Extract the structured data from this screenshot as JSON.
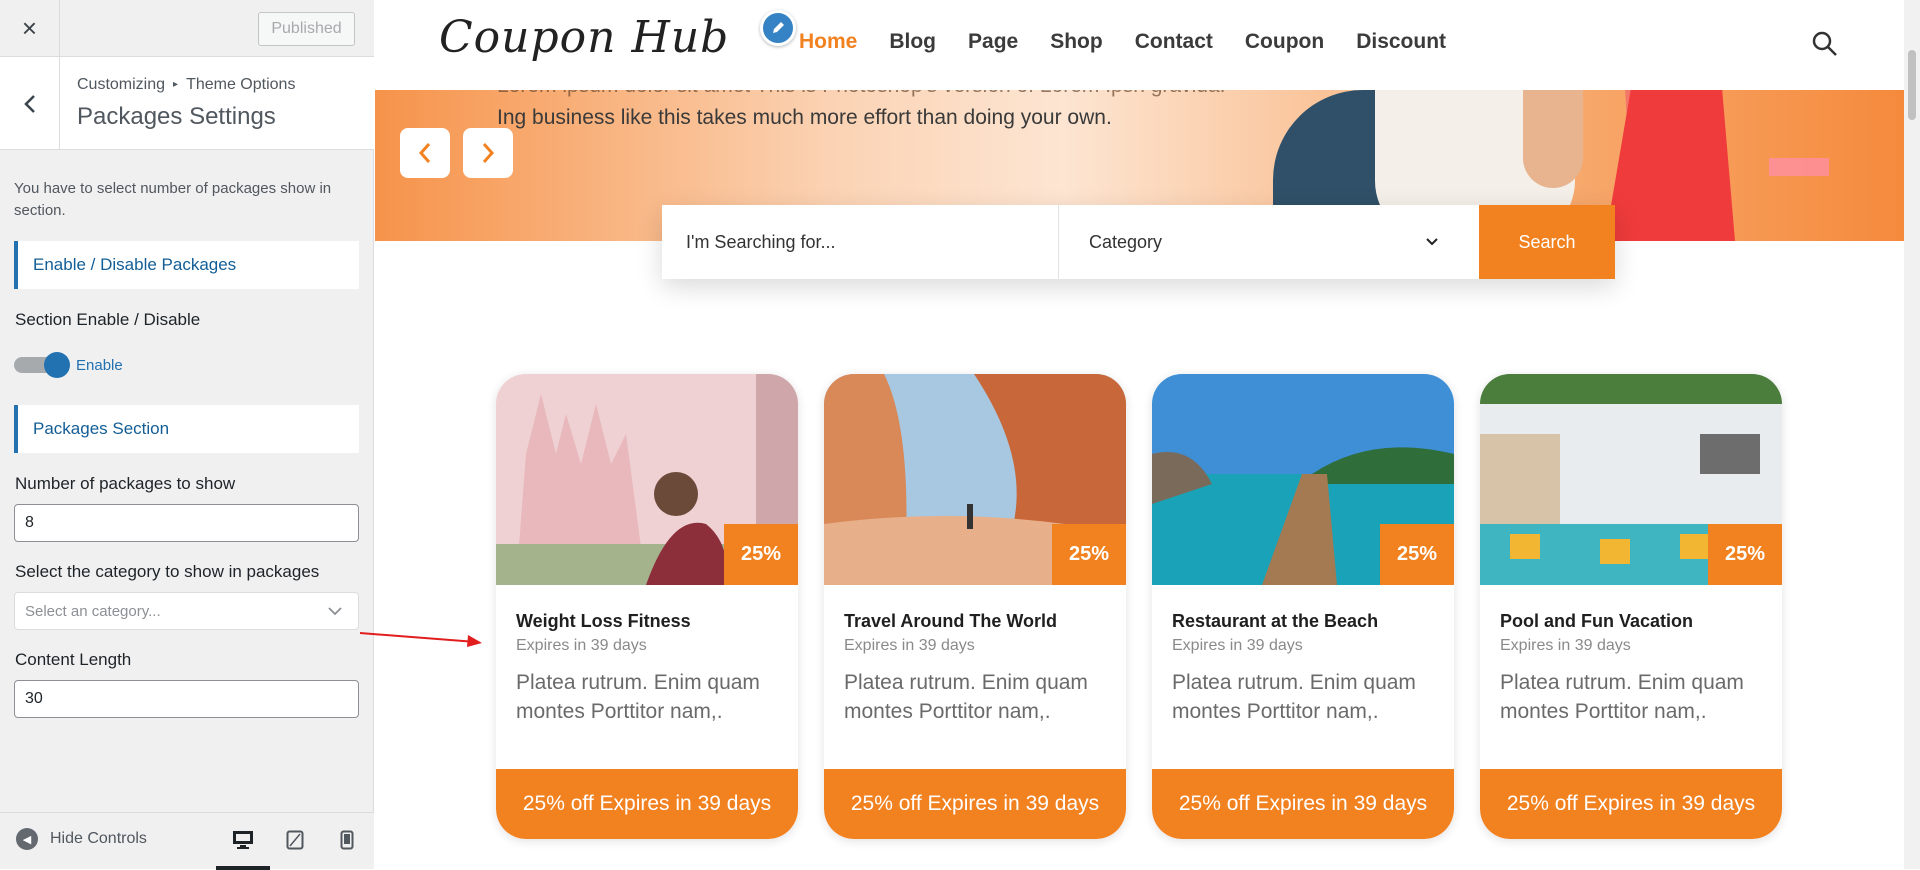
{
  "customizer": {
    "close_icon": "×",
    "publish_label": "Published",
    "breadcrumb": {
      "root": "Customizing",
      "sep": "▸",
      "parent": "Theme Options"
    },
    "section_title": "Packages Settings",
    "description": "You have to select number of packages show in section.",
    "group_enable": "Enable / Disable Packages",
    "section_enable_label": "Section Enable / Disable",
    "toggle_label": "Enable",
    "group_packages": "Packages Section",
    "num_packages_label": "Number of packages to show",
    "num_packages_value": "8",
    "category_label": "Select the category to show in packages",
    "category_placeholder": "Select an category...",
    "content_length_label": "Content Length",
    "content_length_value": "30",
    "hide_controls": "Hide Controls",
    "accent": "#2271b1"
  },
  "site": {
    "logo": "Coupon Hub",
    "nav": [
      "Home",
      "Blog",
      "Page",
      "Shop",
      "Contact",
      "Coupon",
      "Discount"
    ],
    "hero_line1": "Lorem ipsum dolor sit amet This is Photoshop's version of Lorem Ipsn gravida.",
    "hero_line2": "Ing business like this takes much more effort than doing your own.",
    "search_placeholder": "I'm Searching for...",
    "category": "Category",
    "search_button": "Search",
    "accent": "#f28120"
  },
  "cards": [
    {
      "badge": "25%",
      "title": "Weight Loss Fitness",
      "expires": "Expires in 39 days",
      "text": "Platea rutrum. Enim quam montes Porttitor nam,.",
      "footer": "25% off Expires in 39 days"
    },
    {
      "badge": "25%",
      "title": "Travel Around The World",
      "expires": "Expires in 39 days",
      "text": "Platea rutrum. Enim quam montes Porttitor nam,.",
      "footer": "25% off Expires in 39 days"
    },
    {
      "badge": "25%",
      "title": "Restaurant at the Beach",
      "expires": "Expires in 39 days",
      "text": "Platea rutrum. Enim quam montes Porttitor nam,.",
      "footer": "25% off Expires in 39 days"
    },
    {
      "badge": "25%",
      "title": "Pool and Fun Vacation",
      "expires": "Expires in 39 days",
      "text": "Platea rutrum. Enim quam montes Porttitor nam,.",
      "footer": "25% off Expires in 39 days"
    }
  ]
}
